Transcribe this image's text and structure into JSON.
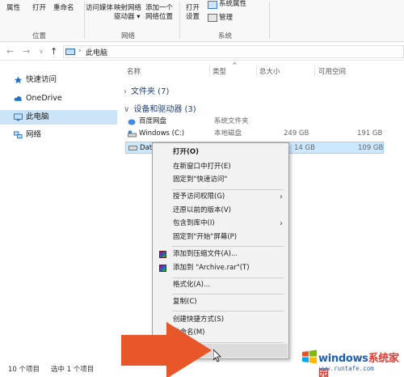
{
  "ribbon": {
    "items": [
      {
        "label": "属性"
      },
      {
        "label": "打开"
      },
      {
        "label": "重命名"
      },
      {
        "label": "访问媒体"
      },
      {
        "label": "映射网络\n驱动器 ▾"
      },
      {
        "label": "添加一个\n网络位置"
      },
      {
        "label": "打开\n设置"
      },
      {
        "label": "系统属性"
      },
      {
        "label": "管理"
      }
    ],
    "groups": [
      "位置",
      "网络",
      "系统"
    ]
  },
  "address": {
    "back": "←",
    "forward": "→",
    "dropdown": "∨",
    "up": "↑",
    "path_sep": "›",
    "location": "此电脑"
  },
  "sidebar": {
    "items": [
      {
        "label": "快速访问",
        "icon": "star-icon"
      },
      {
        "label": "OneDrive",
        "icon": "cloud-icon"
      },
      {
        "label": "此电脑",
        "icon": "computer-icon",
        "active": true
      },
      {
        "label": "网络",
        "icon": "network-icon"
      }
    ]
  },
  "columns": {
    "name": "名称",
    "type": "类型",
    "total": "总大小",
    "free": "可用空间",
    "sort_indicator": "^"
  },
  "sections": [
    {
      "label": "文件夹 (7)",
      "chevron": "›"
    },
    {
      "label": "设备和驱动器 (3)",
      "chevron": "∨"
    }
  ],
  "drives": [
    {
      "name": "百度网盘",
      "type": "系统文件夹",
      "total": "",
      "free": ""
    },
    {
      "name": "Windows (C:)",
      "type": "本地磁盘",
      "total": "249 GB",
      "free": "191 GB"
    },
    {
      "name": "Dat",
      "type": "",
      "total": "14 GB",
      "free": "109 GB",
      "selected": true
    }
  ],
  "context_menu": {
    "items": [
      {
        "label": "打开(O)",
        "bold": true
      },
      {
        "label": "在新窗口中打开(E)"
      },
      {
        "label": "固定到\"快速访问\""
      },
      {
        "label": "授予访问权限(G)",
        "submenu": true
      },
      {
        "label": "还原以前的版本(V)"
      },
      {
        "label": "包含到库中(I)",
        "submenu": true
      },
      {
        "label": "固定到\"开始\"屏幕(P)"
      },
      {
        "label": "添加到压缩文件(A)...",
        "icon": "winrar-icon"
      },
      {
        "label": "添加到 \"Archive.rar\"(T)",
        "icon": "winrar-icon"
      },
      {
        "label": "格式化(A)..."
      },
      {
        "label": "复制(C)"
      },
      {
        "label": "创建快捷方式(S)"
      },
      {
        "label": "重命名(M)"
      },
      {
        "label": "属性(R)",
        "hovered": true
      }
    ],
    "submenu_arrow": "›"
  },
  "status": {
    "count": "10 个项目",
    "selected": "选中 1 个项目"
  },
  "watermark": {
    "brand_main": "windows",
    "brand_accent": "系统家园",
    "url": "www.runtafe.com"
  },
  "colors": {
    "accent": "#0078d7",
    "selection": "#cce8ff",
    "arrow": "#e8572a"
  }
}
